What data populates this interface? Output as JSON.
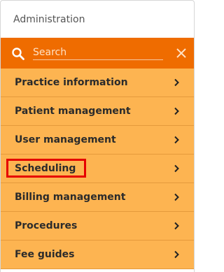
{
  "panel": {
    "title": "Administration"
  },
  "search": {
    "placeholder": "Search",
    "value": "",
    "search_icon": "search-icon",
    "clear_icon": "close-icon"
  },
  "colors": {
    "search_bar": "#ef6c00",
    "menu_background": "#fdb451",
    "highlight": "#e60000"
  },
  "menu": {
    "items": [
      {
        "label": "Practice information",
        "icon": "chevron-right-icon"
      },
      {
        "label": "Patient management",
        "icon": "chevron-right-icon"
      },
      {
        "label": "User management",
        "icon": "chevron-right-icon"
      },
      {
        "label": "Scheduling",
        "icon": "chevron-right-icon",
        "highlighted": true
      },
      {
        "label": "Billing management",
        "icon": "chevron-right-icon"
      },
      {
        "label": "Procedures",
        "icon": "chevron-right-icon"
      },
      {
        "label": "Fee guides",
        "icon": "chevron-right-icon"
      }
    ]
  }
}
